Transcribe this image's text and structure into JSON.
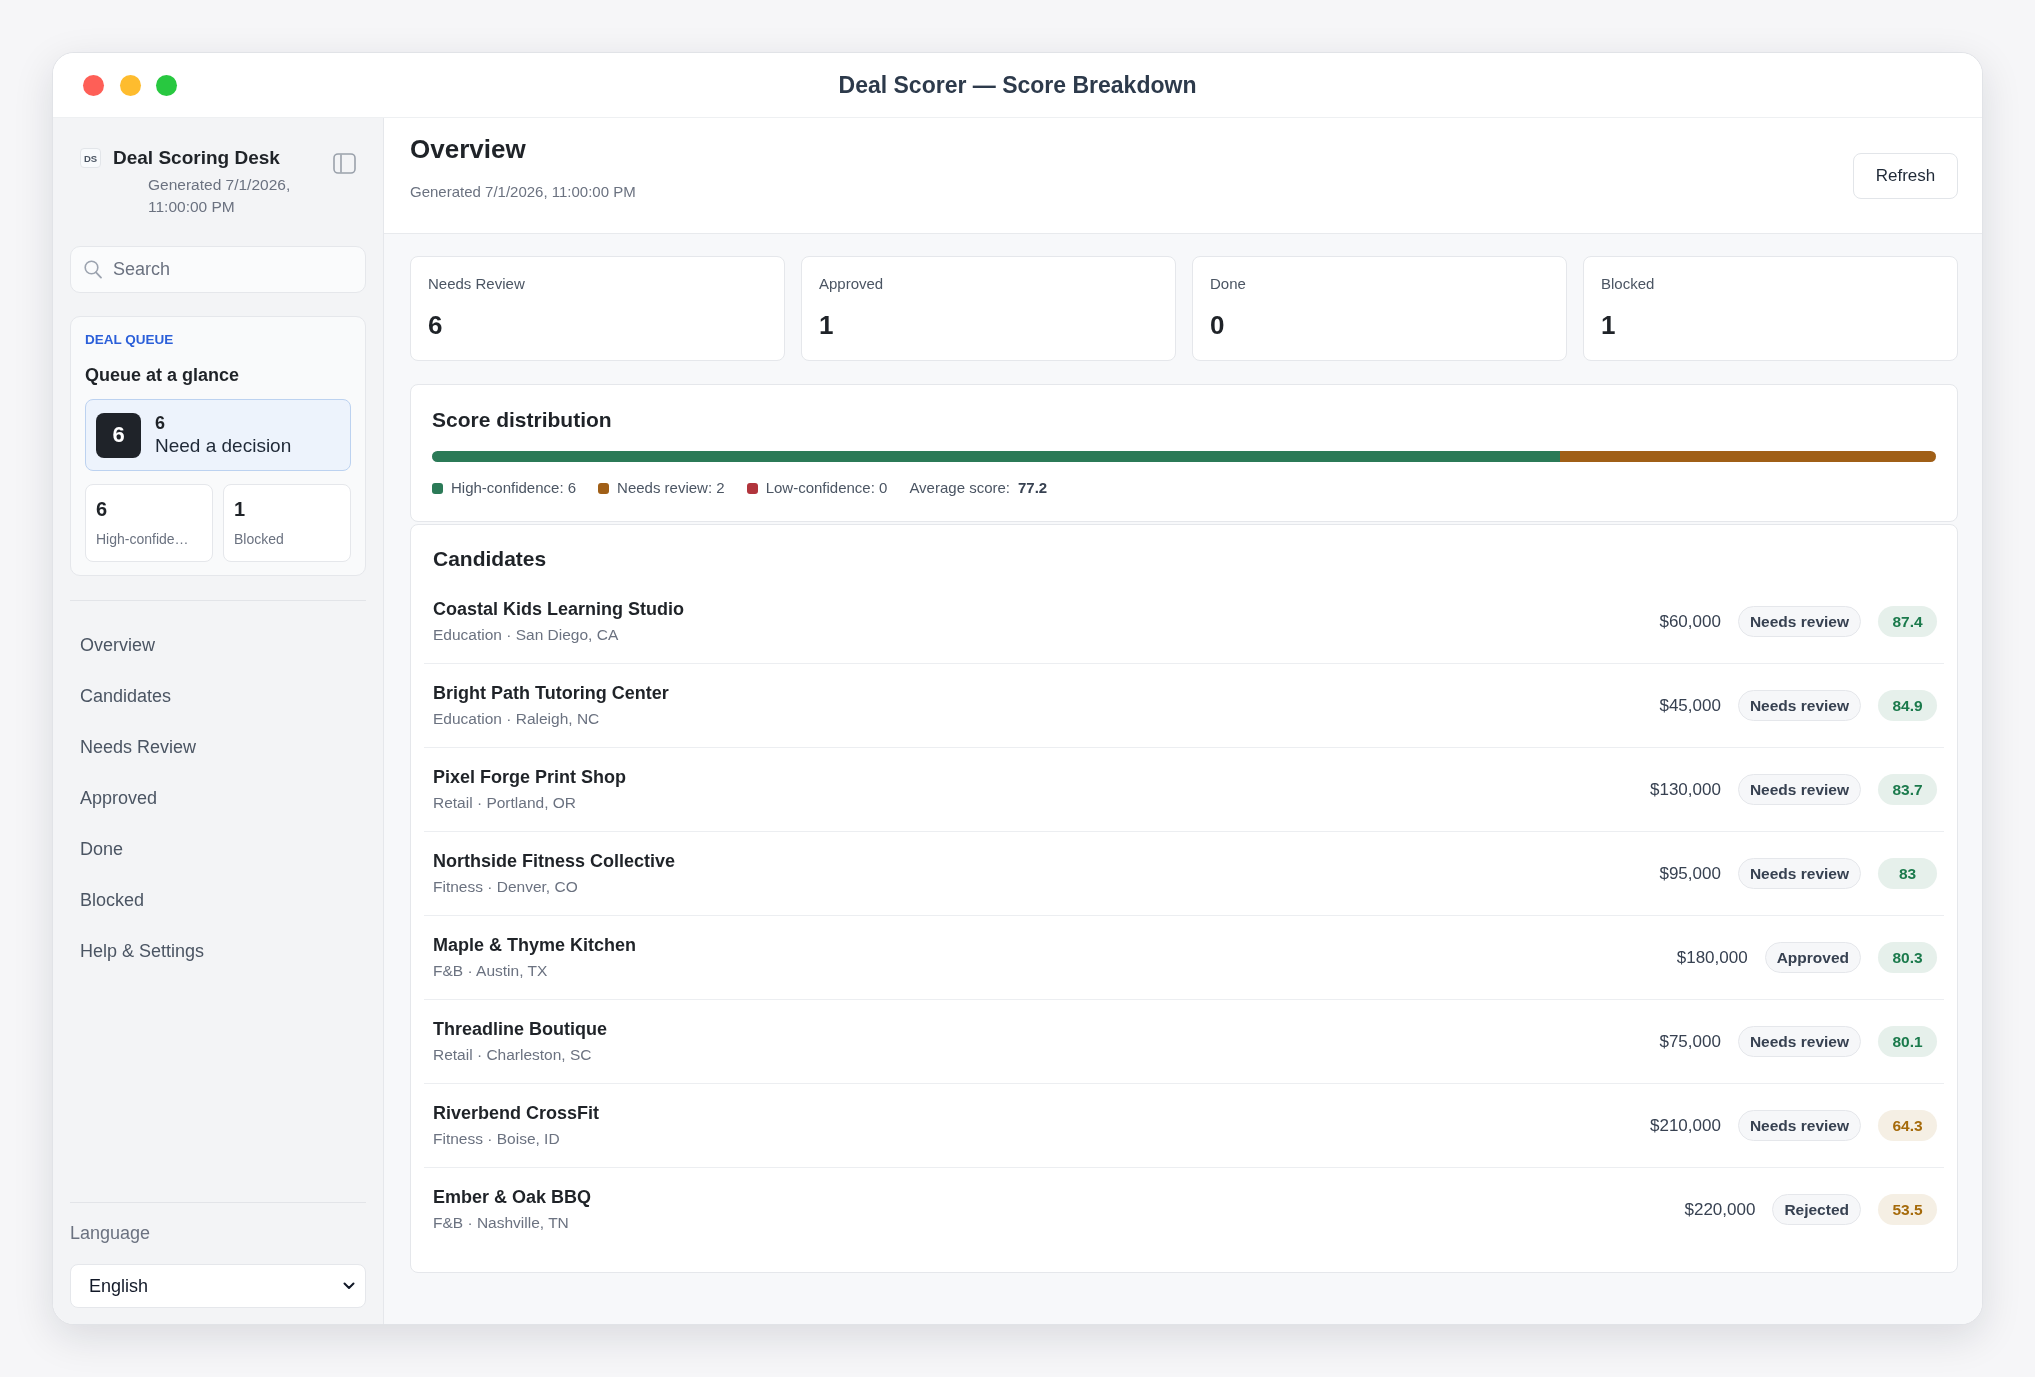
{
  "window": {
    "title": "Deal Scorer — Score Breakdown"
  },
  "sidebar": {
    "logo": "DS",
    "title": "Deal Scoring Desk",
    "subtitle": "Generated 7/1/2026, 11:00:00 PM",
    "search": {
      "placeholder": "Search"
    },
    "queue": {
      "eyebrow": "DEAL QUEUE",
      "title": "Queue at a glance",
      "highlight": {
        "badge": "6",
        "count": "6",
        "label": "Need a decision"
      },
      "tiles": [
        {
          "value": "6",
          "label": "High-confide…"
        },
        {
          "value": "1",
          "label": "Blocked"
        }
      ]
    },
    "nav": [
      "Overview",
      "Candidates",
      "Needs Review",
      "Approved",
      "Done",
      "Blocked",
      "Help & Settings"
    ],
    "language": {
      "label": "Language",
      "value": "English"
    }
  },
  "header": {
    "title": "Overview",
    "subtitle": "Generated 7/1/2026, 11:00:00 PM",
    "refresh_button": "Refresh"
  },
  "stats": [
    {
      "label": "Needs Review",
      "value": "6"
    },
    {
      "label": "Approved",
      "value": "1"
    },
    {
      "label": "Done",
      "value": "0"
    },
    {
      "label": "Blocked",
      "value": "1"
    }
  ],
  "distribution": {
    "title": "Score distribution",
    "bar": [
      {
        "level": 0.75
      },
      {
        "level": 0.25
      }
    ],
    "legend": [
      {
        "label": "High-confidence: 6",
        "color": "#2b7a57"
      },
      {
        "label": "Needs review: 2",
        "color": "#a05f17"
      },
      {
        "label": "Low-confidence: 0",
        "color": "#b1343c"
      }
    ],
    "average": {
      "label": "Average score:",
      "value": "77.2"
    }
  },
  "candidates": {
    "title": "Candidates",
    "rows": [
      {
        "name": "Coastal Kids Learning Studio",
        "meta": "Education · San Diego, CA",
        "amount": "$60,000",
        "status": "Needs review",
        "score": "87.4",
        "color": "#1b7a4c"
      },
      {
        "name": "Bright Path Tutoring Center",
        "meta": "Education · Raleigh, NC",
        "amount": "$45,000",
        "status": "Needs review",
        "score": "84.9",
        "color": "#1b7a4c"
      },
      {
        "name": "Pixel Forge Print Shop",
        "meta": "Retail · Portland, OR",
        "amount": "$130,000",
        "status": "Needs review",
        "score": "83.7",
        "color": "#1b7a4c"
      },
      {
        "name": "Northside Fitness Collective",
        "meta": "Fitness · Denver, CO",
        "amount": "$95,000",
        "status": "Needs review",
        "score": "83",
        "color": "#1b7a4c"
      },
      {
        "name": "Maple & Thyme Kitchen",
        "meta": "F&B · Austin, TX",
        "amount": "$180,000",
        "status": "Approved",
        "score": "80.3",
        "color": "#1b7a4c"
      },
      {
        "name": "Threadline Boutique",
        "meta": "Retail · Charleston, SC",
        "amount": "$75,000",
        "status": "Needs review",
        "score": "80.1",
        "color": "#1b7a4c"
      },
      {
        "name": "Riverbend CrossFit",
        "meta": "Fitness · Boise, ID",
        "amount": "$210,000",
        "status": "Needs review",
        "score": "64.3",
        "color": "#a56a0a"
      },
      {
        "name": "Ember & Oak BBQ",
        "meta": "F&B · Nashville, TN",
        "amount": "$220,000",
        "status": "Rejected",
        "score": "53.5",
        "color": "#a56a0a"
      }
    ]
  }
}
